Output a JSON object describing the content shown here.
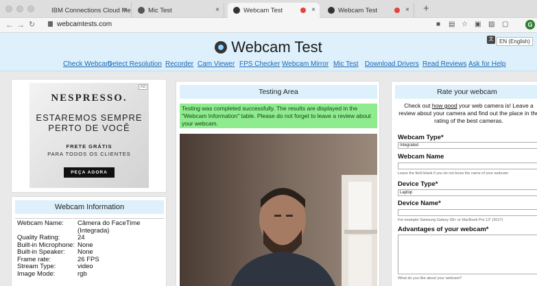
{
  "browser": {
    "tabs": [
      {
        "label": "IBM Connections Cloud Meetin",
        "active": false,
        "recording": false
      },
      {
        "label": "Mic Test",
        "active": false,
        "recording": false
      },
      {
        "label": "Webcam Test",
        "active": true,
        "recording": true
      },
      {
        "label": "Webcam Test",
        "active": false,
        "recording": true
      }
    ],
    "new_tab": "+",
    "url": "webcamtests.com",
    "profile_initial": "G"
  },
  "site": {
    "title": "Webcam Test",
    "language": "EN (English)",
    "nav": [
      "Check Webcam",
      "Detect Resolution",
      "Recorder",
      "Cam Viewer",
      "FPS Checker",
      "Webcam Mirror",
      "Mic Test",
      "Download Drivers",
      "Read Reviews",
      "Ask for Help"
    ]
  },
  "ad": {
    "badge": "Ad",
    "brand": "NESPRESSO.",
    "line1": "ESTAREMOS SEMPRE",
    "line2": "PERTO DE VOCÊ",
    "small1": "FRETE GRÁTIS",
    "small2": "PARA TODOS OS CLIENTES",
    "cta": "PEÇA AGORA"
  },
  "info": {
    "title": "Webcam Information",
    "rows": [
      {
        "k": "Webcam Name:",
        "v": "Câmera do FaceTime (Integrada)"
      },
      {
        "k": "Quality Rating:",
        "v": "24"
      },
      {
        "k": "Built-in Microphone:",
        "v": "None"
      },
      {
        "k": "Built-in Speaker:",
        "v": "None"
      },
      {
        "k": "Frame rate:",
        "v": "26 FPS"
      },
      {
        "k": "Stream Type:",
        "v": "video"
      },
      {
        "k": "Image Mode:",
        "v": "rgb"
      }
    ]
  },
  "testing": {
    "title": "Testing Area",
    "message": "Testing was completed successfully. The results are displayed in the \"Webcam Information\" table. Please do not forget to leave a review about your webcam."
  },
  "rate": {
    "title": "Rate your webcam",
    "intro_pre": "Check out ",
    "intro_link": "how good",
    "intro_post": " your web camera is! Leave a review about your camera and find out the place in the rating of the best cameras.",
    "type_label": "Webcam Type*",
    "type_value": "Integrated",
    "name_label": "Webcam Name",
    "name_hint": "Leave the field blank if you do not know the name of your webcam",
    "device_type_label": "Device Type*",
    "device_type_value": "Laptop",
    "device_name_label": "Device Name*",
    "device_name_hint": "For example Samsung Galaxy S8+ or MacBook Pro 13\" (2017)",
    "advantages_label": "Advantages of your webcam*",
    "advantages_hint": "What do you like about your webcam?"
  }
}
